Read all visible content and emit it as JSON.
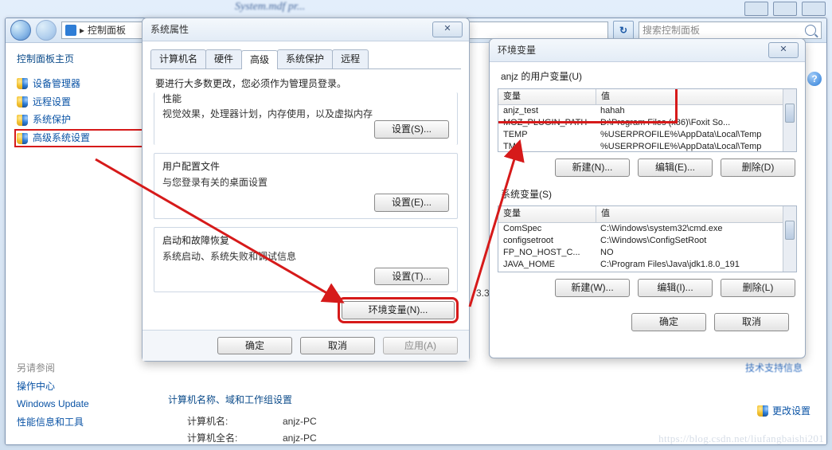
{
  "bg_title": "System.mdf  pr...",
  "explorer": {
    "breadcrumb_sep": "▸",
    "breadcrumb": "控制面板",
    "search_placeholder": "搜索控制面板",
    "refresh_icon": "↻",
    "sidebar": {
      "home": "控制面板主页",
      "items": [
        {
          "label": "设备管理器"
        },
        {
          "label": "远程设置"
        },
        {
          "label": "系统保护"
        },
        {
          "label": "高级系统设置"
        }
      ],
      "lower_heading": "另请参阅",
      "lower_items": [
        {
          "label": "操作中心"
        },
        {
          "label": "Windows Update"
        },
        {
          "label": "性能信息和工具"
        }
      ]
    },
    "main": {
      "section_title": "计算机名称、域和工作组设置",
      "rows": [
        {
          "k": "计算机名:",
          "v": "anjz-PC"
        },
        {
          "k": "计算机全名:",
          "v": "anjz-PC"
        }
      ],
      "change_link": "更改设置",
      "blur_text": "技术支持信息",
      "help_icon": "?"
    }
  },
  "sysprop": {
    "title": "系统属性",
    "close_icon": "✕",
    "tabs": [
      "计算机名",
      "硬件",
      "高级",
      "系统保护",
      "远程"
    ],
    "active_tab_index": 2,
    "admin_note": "要进行大多数更改，您必须作为管理员登录。",
    "groups": [
      {
        "label": "性能",
        "desc": "视觉效果，处理器计划，内存使用，以及虚拟内存",
        "btn": "设置(S)..."
      },
      {
        "label": "用户配置文件",
        "desc": "与您登录有关的桌面设置",
        "btn": "设置(E)..."
      },
      {
        "label": "启动和故障恢复",
        "desc": "系统启动、系统失败和调试信息",
        "btn": "设置(T)..."
      }
    ],
    "env_btn": "环境变量(N)...",
    "ok": "确定",
    "cancel": "取消",
    "apply": "应用(A)"
  },
  "envdlg": {
    "title": "环境变量",
    "close_icon": "✕",
    "user_header": "anjz 的用户变量(U)",
    "col_var": "变量",
    "col_val": "值",
    "user_vars": [
      {
        "var": "anjz_test",
        "val": "hahah"
      },
      {
        "var": "MOZ_PLUGIN_PATH",
        "val": "D:\\Program Files (x86)\\Foxit So..."
      },
      {
        "var": "TEMP",
        "val": "%USERPROFILE%\\AppData\\Local\\Temp"
      },
      {
        "var": "TMP",
        "val": "%USERPROFILE%\\AppData\\Local\\Temp"
      }
    ],
    "user_btns": {
      "new": "新建(N)...",
      "edit": "编辑(E)...",
      "del": "删除(D)"
    },
    "sys_header": "系统变量(S)",
    "sys_vars": [
      {
        "var": "ComSpec",
        "val": "C:\\Windows\\system32\\cmd.exe"
      },
      {
        "var": "configsetroot",
        "val": "C:\\Windows\\ConfigSetRoot"
      },
      {
        "var": "FP_NO_HOST_C...",
        "val": "NO"
      },
      {
        "var": "JAVA_HOME",
        "val": "C:\\Program Files\\Java\\jdk1.8.0_191"
      }
    ],
    "sys_btns": {
      "new": "新建(W)...",
      "edit": "编辑(I)...",
      "del": "删除(L)"
    },
    "ok": "确定",
    "cancel": "取消"
  },
  "side_float": "3.3",
  "watermark": "https://blog.csdn.net/liufangbaishi201"
}
